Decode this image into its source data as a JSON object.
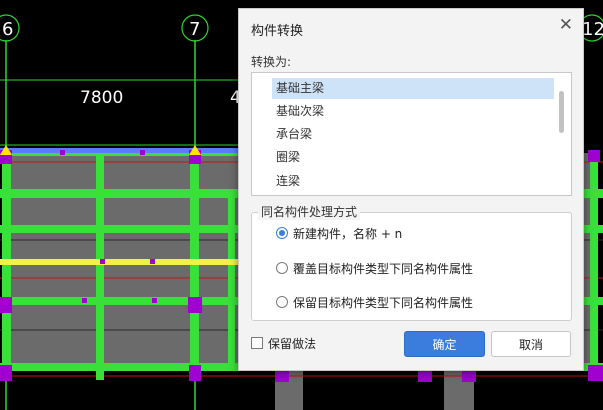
{
  "cad": {
    "axis_left": "6",
    "axis_mid": "7",
    "axis_right": "12",
    "dimension": "7800",
    "dimension_partial": "4"
  },
  "dialog": {
    "title": "构件转换",
    "close_icon": "close-icon",
    "convert_label": "转换为:",
    "options": [
      "基础主梁",
      "基础次梁",
      "承台梁",
      "圈梁",
      "连梁"
    ],
    "selected_option": "基础主梁",
    "group_title": "同名构件处理方式",
    "radios": [
      {
        "label": "新建构件，名称 + n",
        "checked": true
      },
      {
        "label": "覆盖目标构件类型下同名构件属性",
        "checked": false
      },
      {
        "label": "保留目标构件类型下同名构件属性",
        "checked": false
      }
    ],
    "keep_method_label": "保留做法",
    "keep_method_checked": false,
    "ok_label": "确定",
    "cancel_label": "取消",
    "accent_color": "#3b7ddd"
  }
}
